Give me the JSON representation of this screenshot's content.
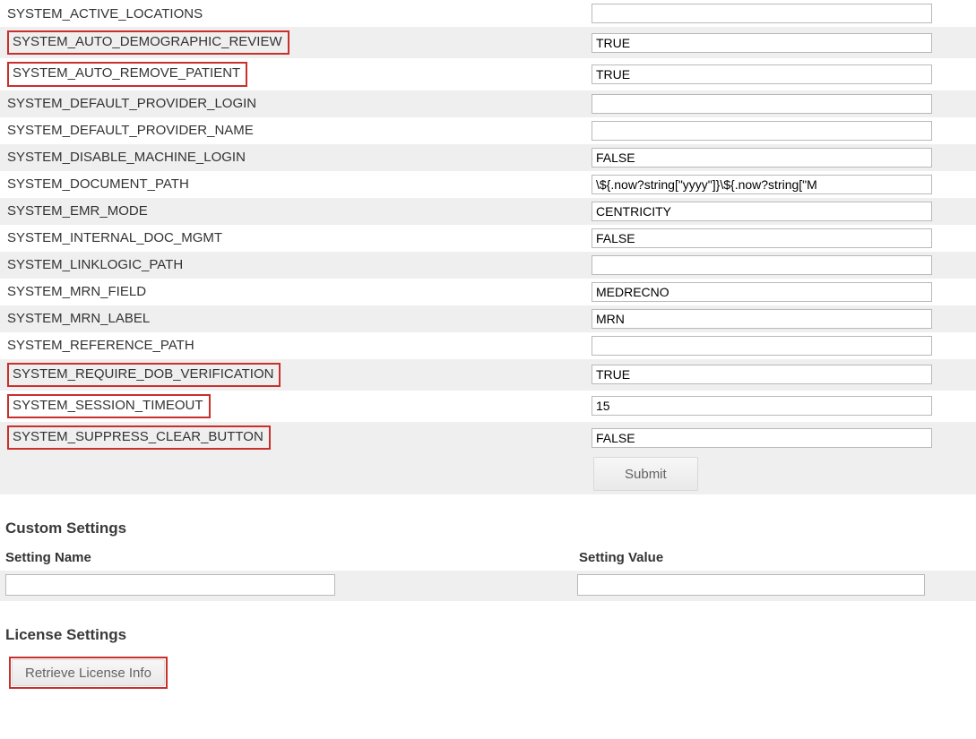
{
  "settings": [
    {
      "name": "SYSTEM_ACTIVE_LOCATIONS",
      "value": "",
      "highlight": false,
      "row": "odd"
    },
    {
      "name": "SYSTEM_AUTO_DEMOGRAPHIC_REVIEW",
      "value": "TRUE",
      "highlight": true,
      "row": "even"
    },
    {
      "name": "SYSTEM_AUTO_REMOVE_PATIENT",
      "value": "TRUE",
      "highlight": true,
      "row": "odd"
    },
    {
      "name": "SYSTEM_DEFAULT_PROVIDER_LOGIN",
      "value": "",
      "highlight": false,
      "row": "even"
    },
    {
      "name": "SYSTEM_DEFAULT_PROVIDER_NAME",
      "value": "",
      "highlight": false,
      "row": "odd"
    },
    {
      "name": "SYSTEM_DISABLE_MACHINE_LOGIN",
      "value": "FALSE",
      "highlight": false,
      "row": "even"
    },
    {
      "name": "SYSTEM_DOCUMENT_PATH",
      "value": "\\${.now?string[\"yyyy\"]}\\${.now?string[\"M",
      "highlight": false,
      "row": "odd"
    },
    {
      "name": "SYSTEM_EMR_MODE",
      "value": "CENTRICITY",
      "highlight": false,
      "row": "even"
    },
    {
      "name": "SYSTEM_INTERNAL_DOC_MGMT",
      "value": "FALSE",
      "highlight": false,
      "row": "odd"
    },
    {
      "name": "SYSTEM_LINKLOGIC_PATH",
      "value": "",
      "highlight": false,
      "row": "even"
    },
    {
      "name": "SYSTEM_MRN_FIELD",
      "value": "MEDRECNO",
      "highlight": false,
      "row": "odd"
    },
    {
      "name": "SYSTEM_MRN_LABEL",
      "value": "MRN",
      "highlight": false,
      "row": "even"
    },
    {
      "name": "SYSTEM_REFERENCE_PATH",
      "value": "",
      "highlight": false,
      "row": "odd"
    },
    {
      "name": "SYSTEM_REQUIRE_DOB_VERIFICATION",
      "value": "TRUE",
      "highlight": true,
      "row": "even"
    },
    {
      "name": "SYSTEM_SESSION_TIMEOUT",
      "value": "15",
      "highlight": true,
      "row": "odd"
    },
    {
      "name": "SYSTEM_SUPPRESS_CLEAR_BUTTON",
      "value": "FALSE",
      "highlight": true,
      "row": "even"
    }
  ],
  "buttons": {
    "submit": "Submit",
    "retrieve_license": "Retrieve License Info"
  },
  "headings": {
    "custom_settings": "Custom Settings",
    "license_settings": "License Settings"
  },
  "custom": {
    "name_label": "Setting Name",
    "value_label": "Setting Value",
    "name_value": "",
    "value_value": ""
  }
}
